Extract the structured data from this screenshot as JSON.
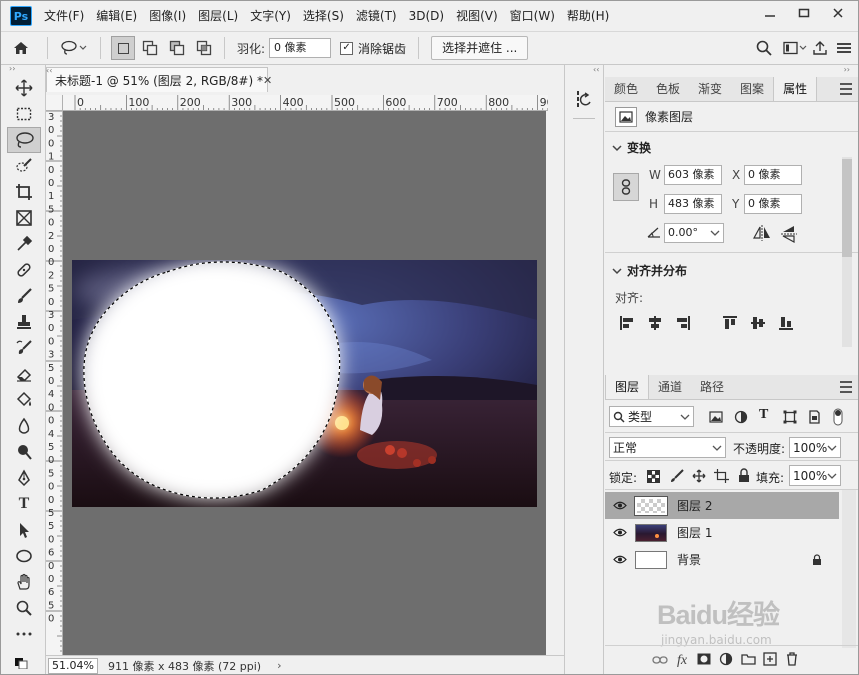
{
  "app": {
    "logo": "Ps"
  },
  "menu": [
    "文件(F)",
    "编辑(E)",
    "图像(I)",
    "图层(L)",
    "文字(Y)",
    "选择(S)",
    "滤镜(T)",
    "3D(D)",
    "视图(V)",
    "窗口(W)",
    "帮助(H)"
  ],
  "options": {
    "feather_label": "羽化:",
    "feather_value": "0 像素",
    "antialias_label": "消除锯齿",
    "antialias_checked": true,
    "select_mask_button": "选择并遮住 ..."
  },
  "document": {
    "tab_title": "未标题-1 @ 51% (图层 2, RGB/8#) *",
    "ruler_h": [
      "0",
      "100",
      "200",
      "300",
      "400",
      "500",
      "600",
      "700",
      "800",
      "90"
    ],
    "ruler_v": [
      "3",
      "0",
      "0",
      "1",
      "0",
      "0",
      "1",
      "5",
      "0",
      "2",
      "0",
      "0",
      "2",
      "5",
      "0",
      "3",
      "0",
      "0",
      "3",
      "5",
      "0",
      "4",
      "0",
      "0",
      "4",
      "5",
      "0",
      "5",
      "0",
      "0",
      "5",
      "5",
      "0",
      "6",
      "0",
      "0",
      "6",
      "5",
      "0"
    ],
    "zoom": "51.04%",
    "doc_info": "911 像素 x 483 像素 (72 ppi)"
  },
  "properties_panel": {
    "tabs": [
      "颜色",
      "色板",
      "渐变",
      "图案",
      "属性"
    ],
    "active_tab": "属性",
    "kind": "像素图层",
    "transform_title": "变换",
    "w_label": "W",
    "w_value": "603 像素",
    "h_label": "H",
    "h_value": "483 像素",
    "x_label": "X",
    "x_value": "0 像素",
    "y_label": "Y",
    "y_value": "0 像素",
    "angle_value": "0.00°",
    "align_title": "对齐并分布",
    "align_label": "对齐:"
  },
  "layers_panel": {
    "tabs": [
      "图层",
      "通道",
      "路径"
    ],
    "active_tab": "图层",
    "filter_kind": "类型",
    "blend_mode": "正常",
    "opacity_label": "不透明度:",
    "opacity_value": "100%",
    "lock_label": "锁定:",
    "fill_label": "填充:",
    "fill_value": "100%",
    "layers": [
      {
        "name": "图层 2",
        "selected": true
      },
      {
        "name": "图层 1",
        "selected": false
      },
      {
        "name": "背景",
        "selected": false,
        "locked": true
      }
    ]
  },
  "watermark": {
    "brand": "Baidu经验",
    "url": "jingyan.baidu.com"
  }
}
